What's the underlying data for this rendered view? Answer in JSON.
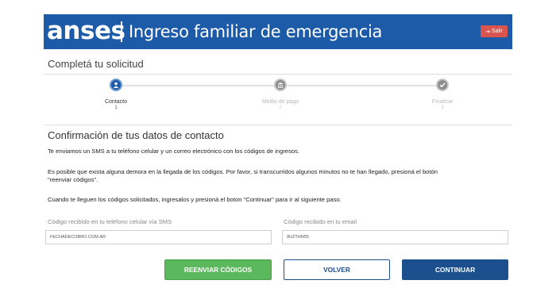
{
  "header": {
    "brand": "anses",
    "title": "Ingreso familiar de emergencia",
    "exit_label": "Salir",
    "exit_icon": "exit-icon"
  },
  "page_title": "Completá tu solicitud",
  "steps": [
    {
      "label": "Contacto",
      "number": "1",
      "state": "active",
      "icon": "user-icon"
    },
    {
      "label": "Medio de pago",
      "number": "2",
      "state": "inactive",
      "icon": "bank-icon"
    },
    {
      "label": "Finalizar",
      "number": "3",
      "state": "inactive",
      "icon": "check-icon"
    }
  ],
  "section": {
    "title": "Confirmación de tus datos de contacto",
    "p1": "Te enviamos un SMS a tu teléfono celular y un correo electrónico con los códigos de ingresos.",
    "p2_line1": "Es posible que exista alguna demora en la llegada de los códigos. Por favor, si transcurridos algunos minutos no te han llegado, presioná el botón",
    "p2_line2": "\"reenviar códigos\".",
    "p3": "Cuando te lleguen los códigos solicitados, ingresalos y presioná el boton \"Continuar\" para ir al siguiente paso."
  },
  "form": {
    "sms_label": "Código recibido en tu teléfono celular vía SMS",
    "sms_value": "FECHADECOBRO.COM.AR",
    "email_label": "Código recibido en tu email",
    "email_value": "9UZTHN55"
  },
  "buttons": {
    "resend": "REENVIAR CÓDIGOS",
    "back": "VOLVER",
    "continue": "CONTINUAR"
  },
  "colors": {
    "brand_blue": "#1d5aa8",
    "exit_red": "#d9534f",
    "resend_green": "#5bb85c",
    "continue_blue": "#1b4f8d"
  }
}
